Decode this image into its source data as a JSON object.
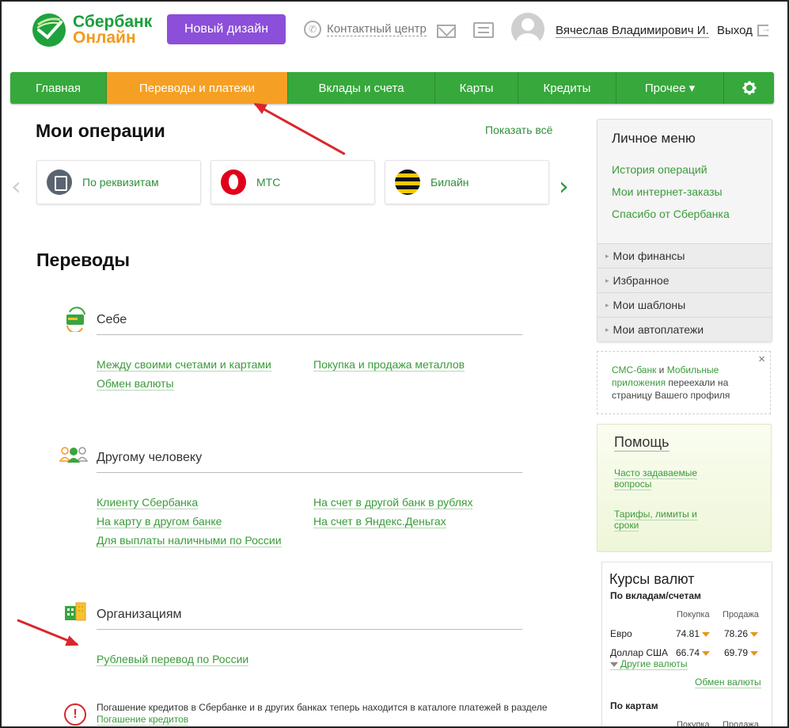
{
  "header": {
    "logo_line1": "Сбербанк",
    "logo_line2": "Онлайн",
    "new_design_button": "Новый дизайн",
    "contact_center": "Контактный центр",
    "username": "Вячеслав Владимирович И.",
    "logout": "Выход"
  },
  "nav": {
    "items": [
      "Главная",
      "Переводы и платежи",
      "Вклады и счета",
      "Карты",
      "Кредиты",
      "Прочее ▾"
    ]
  },
  "operations": {
    "title": "Мои операции",
    "show_all": "Показать всё",
    "cards": [
      "По реквизитам",
      "МТС",
      "Билайн"
    ]
  },
  "transfers": {
    "title": "Переводы",
    "sections": [
      {
        "title": "Себе",
        "links": [
          "Между своими счетами и картами",
          "Обмен валюты",
          "Покупка и продажа металлов"
        ]
      },
      {
        "title": "Другому человеку",
        "links": [
          "Клиенту Сбербанка",
          "На карту в другом банке",
          "Для выплаты наличными по России",
          "На счет в другой банк в рублях",
          "На счет в Яндекс.Деньгах"
        ]
      },
      {
        "title": "Организациям",
        "links": [
          "Рублевый перевод по России"
        ]
      }
    ],
    "notice_text": "Погашение кредитов в Сбербанке и в других банках теперь находится в каталоге платежей в разделе",
    "notice_link": "Погашение кредитов"
  },
  "personal_menu": {
    "title": "Личное меню",
    "links": [
      "История операций",
      "Мои интернет-заказы",
      "Спасибо от Сбербанка"
    ],
    "rows": [
      "Мои финансы",
      "Избранное",
      "Мои шаблоны",
      "Мои автоплатежи"
    ]
  },
  "sms_notice": {
    "part1": "СМС-банк",
    "part2": " и ",
    "part3": "Мобильные приложения",
    "part4": " переехали на страницу Вашего профиля",
    "close": "×"
  },
  "help": {
    "title": "Помощь",
    "faq_line1": "Часто задаваемые",
    "faq_line2": "вопросы",
    "tariffs_line1": "Тарифы, лимиты и",
    "tariffs_line2": "сроки"
  },
  "rates": {
    "title": "Курсы валют",
    "by_deposits": "По вкладам/счетам",
    "col_buy": "Покупка",
    "col_sell": "Продажа",
    "rows": [
      {
        "currency": "Евро",
        "buy": "74.81",
        "sell": "78.26"
      },
      {
        "currency": "Доллар США",
        "buy": "66.74",
        "sell": "69.79"
      }
    ],
    "other_currencies": "Другие валюты",
    "exchange": "Обмен валюты",
    "by_cards": "По картам",
    "col_buy2": "Покупка",
    "col_sell2": "Продажа"
  },
  "colors": {
    "brand_green": "#37a83c",
    "active_orange": "#f5a024",
    "new_design_purple": "#8b4fd9",
    "annotation_red": "#d9262c"
  }
}
